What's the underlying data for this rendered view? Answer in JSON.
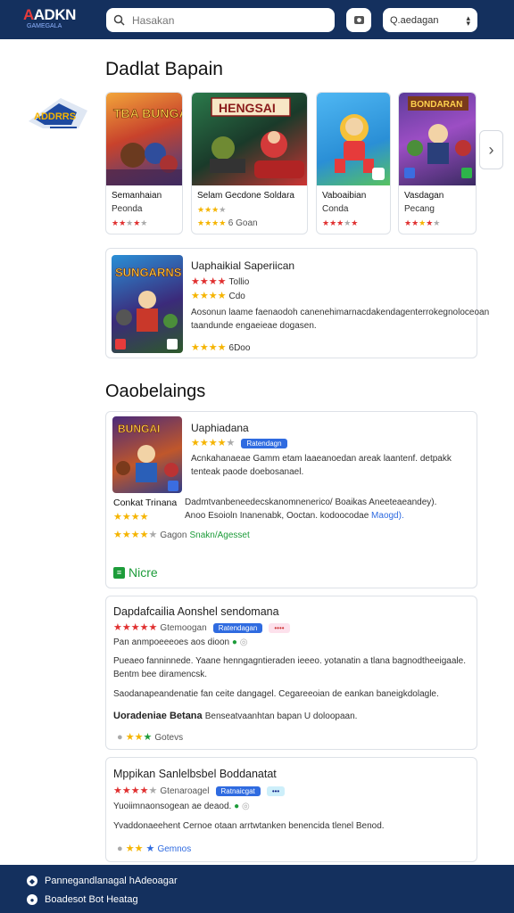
{
  "header": {
    "logo_text_main": "ADKN",
    "logo_text_accent": "A",
    "logo_sub": "GAMEGALA",
    "search_placeholder": "Hasakan",
    "select_label": "Q.aedagan"
  },
  "section1": {
    "title": "Dadlat Bapain",
    "cards": [
      {
        "title": "Semanhaian",
        "sub": "Peonda"
      },
      {
        "title": "Selam Gecdone Soldara",
        "sub": "",
        "rating": "6 Goan"
      },
      {
        "title": "Vaboaibian",
        "sub": "Conda"
      },
      {
        "title": "Vasdagan",
        "sub": "Pecang"
      }
    ],
    "card_banner_2": "HENGSAI",
    "card_banner_1": "TBA BUNGAI",
    "card_banner_4": "BONDARAN",
    "featured": {
      "title": "Uaphaikial Saperiican",
      "meta1": "Tollio",
      "meta2": "Cdo",
      "desc1": "Aosonun laame faenaodoh canenehimarnacdakendagenterrokegnoloceoan",
      "desc2": "taandunde engaeieae dogasen.",
      "meta3": "6Doo",
      "banner": "SUNGARNS"
    }
  },
  "section2": {
    "title": "Oaobelaings",
    "review1": {
      "title": "Uaphiadana",
      "badge": "Ratendagn",
      "desc1": "Acnkahanaeae Gamm etam laaeanoedan areak laantenf. detpakk",
      "desc2": "tenteak paode doebosanael.",
      "left_label": "Conkat Trinana",
      "line1": "Dadmtvanbeneedecskanomnenerico/ Boaikas Aneeteaeandey).",
      "line2": "Anoo Esoioln Inanenabk, Ooctan. kodoocodae",
      "line2_link": "Maogd).",
      "meta_a": "Gagon",
      "meta_b": "Snakn/Agesset",
      "more": "Nicre",
      "banner": "BUNGAI"
    },
    "review2": {
      "title": "Dapdafcailia Aonshel sendomana",
      "meta": "Gtemoogan",
      "badge": "Ratendagan",
      "line1": "Pan anmpoeeeoes aos dioon",
      "p1": "Pueaeo fanninnede. Yaane henngagntieraden ieeeo. yotanatin a tlana bagnodtheeigaale.",
      "p1b": "Bentm bee diramencsk.",
      "p2": "Saodanapeandenatie fan ceite dangagel. Cegareeoian de eankan baneigkdolagle.",
      "footer_bold": "Uoradeniae Betana",
      "footer_text": "Benseatvaanhtan bapan U doloopaan.",
      "footer_meta": "Gotevs"
    },
    "review3": {
      "title": "Mppikan Sanlelbsbel Boddanatat",
      "meta": "Gtenaroagel",
      "badge": "Ratnaicgat",
      "line1": "Yuoiimnaonsogean ae deaod.",
      "p1": "Yvaddonaeehent Cernoe otaan arrtwtanken benencida tlenel Benod.",
      "footer_meta": "Gemnos"
    }
  },
  "footer": {
    "line1": "Pannegandlanagal hAdeoagar",
    "line2": "Boadesot Bot Heatag"
  },
  "colors": {
    "brand": "#14305e",
    "accent_blue": "#2f6be0",
    "star_gold": "#f5b400",
    "star_red": "#e03030",
    "green": "#1d9c3a"
  }
}
